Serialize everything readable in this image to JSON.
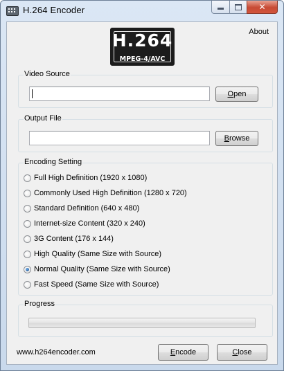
{
  "window": {
    "title": "H.264 Encoder",
    "close_glyph": "✕"
  },
  "logo": {
    "main": "H.264",
    "sub": "MPEG-4/AVC"
  },
  "menu": {
    "about": "About"
  },
  "video_source": {
    "group_label": "Video Source",
    "value": "",
    "button": "Open"
  },
  "output_file": {
    "group_label": "Output File",
    "value": "",
    "button": "Browse"
  },
  "encoding": {
    "group_label": "Encoding Setting",
    "selected_index": 6,
    "options": [
      "Full High Definition (1920 x 1080)",
      "Commonly Used High Definition (1280 x 720)",
      "Standard Definition (640 x 480)",
      "Internet-size Content (320 x 240)",
      "3G Content (176 x 144)",
      "High Quality (Same Size with Source)",
      "Normal Quality (Same Size with Source)",
      "Fast Speed (Same Size with Source)"
    ]
  },
  "progress": {
    "group_label": "Progress",
    "value": 0
  },
  "footer": {
    "url": "www.h264encoder.com",
    "encode_button": "Encode",
    "close_button": "Close"
  },
  "colors": {
    "progress_fill": "#37b34a",
    "close_button": "#c74a34"
  }
}
